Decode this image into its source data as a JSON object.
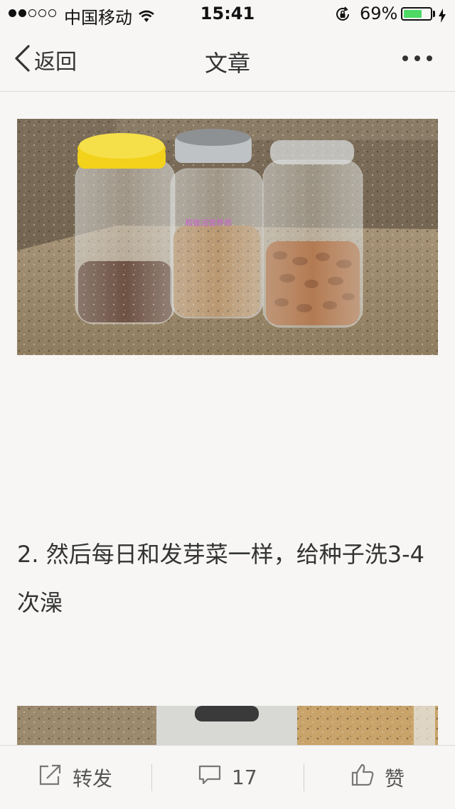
{
  "status_bar": {
    "carrier": "中国移动",
    "time": "15:41",
    "battery_percent": "69%",
    "battery_level": 0.69,
    "signal_bars_filled": 2,
    "signal_bars_total": 5
  },
  "nav": {
    "back_label": "返回",
    "title": "文章"
  },
  "article": {
    "paragraph": "2. 然后每日和发芽菜一样，给种子洗3-4次澡",
    "image_watermark": "和致活营养师"
  },
  "toolbar": {
    "share_label": "转发",
    "comment_count": "17",
    "like_label": "赞"
  },
  "colors": {
    "background": "#f7f6f4",
    "text": "#333333",
    "battery_fill": "#4cd964",
    "jar_lid_yellow": "#f2d21b"
  }
}
